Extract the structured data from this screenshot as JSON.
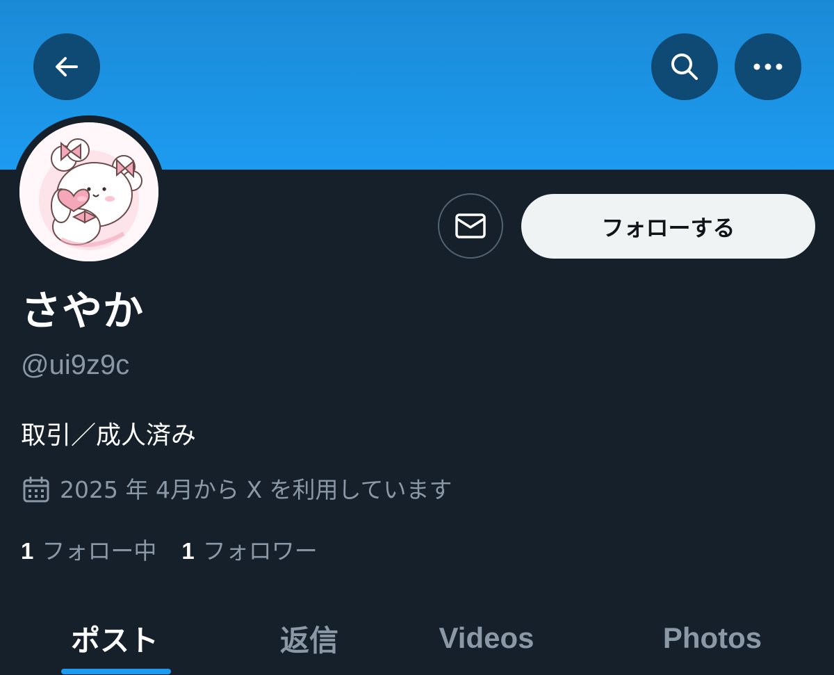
{
  "header": {
    "banner_color": "#1d9bf0",
    "back_icon": "arrow-left-icon",
    "search_icon": "search-icon",
    "more_icon": "more-horizontal-icon"
  },
  "profile": {
    "display_name": "さやか",
    "handle": "@ui9z9c",
    "bio": "取引／成人済み",
    "joined": "2025 年 4月から X を利用しています",
    "avatar_description_icon": "avatar-illustration"
  },
  "actions": {
    "message_icon": "mail-icon",
    "follow_label": "フォローする"
  },
  "stats": {
    "following_count": "1",
    "following_label": "フォロー中",
    "followers_count": "1",
    "followers_label": "フォロワー"
  },
  "tabs": [
    {
      "label": "ポスト",
      "active": true
    },
    {
      "label": "返信",
      "active": false
    },
    {
      "label": "Videos",
      "active": false
    },
    {
      "label": "Photos",
      "active": false
    }
  ],
  "colors": {
    "background": "#15202b",
    "accent": "#1d9bf0",
    "secondary_text": "#8b98a5"
  }
}
